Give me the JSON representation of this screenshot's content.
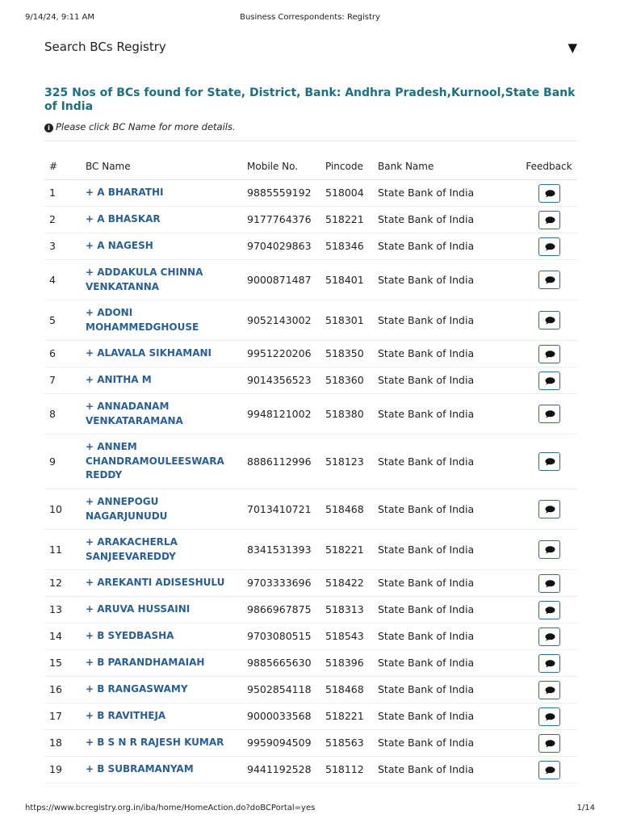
{
  "print_header": {
    "datetime": "9/14/24, 9:11 AM",
    "title": "Business Correspondents: Registry"
  },
  "search": {
    "label": "Search BCs Registry",
    "toggle_icon": "▼"
  },
  "result": {
    "heading": "325 Nos of BCs found for State, District, Bank: Andhra Pradesh,Kurnool,State Bank of India",
    "hint": "Please click BC Name for more details."
  },
  "table": {
    "headers": {
      "num": "#",
      "name": "BC Name",
      "mobile": "Mobile No.",
      "pincode": "Pincode",
      "bank": "Bank Name",
      "feedback": "Feedback"
    },
    "rows": [
      {
        "num": "1",
        "name": "+ A BHARATHI",
        "mobile": "9885559192",
        "pincode": "518004",
        "bank": "State Bank of India"
      },
      {
        "num": "2",
        "name": "+ A BHASKAR",
        "mobile": "9177764376",
        "pincode": "518221",
        "bank": "State Bank of India"
      },
      {
        "num": "3",
        "name": "+ A NAGESH",
        "mobile": "9704029863",
        "pincode": "518346",
        "bank": "State Bank of India"
      },
      {
        "num": "4",
        "name": "+ ADDAKULA CHINNA VENKATANNA",
        "mobile": "9000871487",
        "pincode": "518401",
        "bank": "State Bank of India"
      },
      {
        "num": "5",
        "name": "+ ADONI MOHAMMEDGHOUSE",
        "mobile": "9052143002",
        "pincode": "518301",
        "bank": "State Bank of India"
      },
      {
        "num": "6",
        "name": "+ ALAVALA SIKHAMANI",
        "mobile": "9951220206",
        "pincode": "518350",
        "bank": "State Bank of India"
      },
      {
        "num": "7",
        "name": "+ ANITHA M",
        "mobile": "9014356523",
        "pincode": "518360",
        "bank": "State Bank of India"
      },
      {
        "num": "8",
        "name": "+ ANNADANAM VENKATARAMANA",
        "mobile": "9948121002",
        "pincode": "518380",
        "bank": "State Bank of India"
      },
      {
        "num": "9",
        "name": "+ ANNEM CHANDRAMOULEESWARA REDDY",
        "mobile": "8886112996",
        "pincode": "518123",
        "bank": "State Bank of India"
      },
      {
        "num": "10",
        "name": "+ ANNEPOGU NAGARJUNUDU",
        "mobile": "7013410721",
        "pincode": "518468",
        "bank": "State Bank of India"
      },
      {
        "num": "11",
        "name": "+ ARAKACHERLA SANJEEVAREDDY",
        "mobile": "8341531393",
        "pincode": "518221",
        "bank": "State Bank of India"
      },
      {
        "num": "12",
        "name": "+ AREKANTI ADISESHULU",
        "mobile": "9703333696",
        "pincode": "518422",
        "bank": "State Bank of India"
      },
      {
        "num": "13",
        "name": "+ ARUVA HUSSAINI",
        "mobile": "9866967875",
        "pincode": "518313",
        "bank": "State Bank of India"
      },
      {
        "num": "14",
        "name": "+ B SYEDBASHA",
        "mobile": "9703080515",
        "pincode": "518543",
        "bank": "State Bank of India"
      },
      {
        "num": "15",
        "name": "+ B PARANDHAMAIAH",
        "mobile": "9885665630",
        "pincode": "518396",
        "bank": "State Bank of India"
      },
      {
        "num": "16",
        "name": "+ B RANGASWAMY",
        "mobile": "9502854118",
        "pincode": "518468",
        "bank": "State Bank of India"
      },
      {
        "num": "17",
        "name": "+ B RAVITHEJA",
        "mobile": "9000033568",
        "pincode": "518221",
        "bank": "State Bank of India"
      },
      {
        "num": "18",
        "name": "+ B S N R RAJESH KUMAR",
        "mobile": "9959094509",
        "pincode": "518563",
        "bank": "State Bank of India"
      },
      {
        "num": "19",
        "name": "+ B SUBRAMANYAM",
        "mobile": "9441192528",
        "pincode": "518112",
        "bank": "State Bank of India"
      }
    ],
    "feedback_icon": "comment-icon"
  },
  "print_footer": {
    "url": "https://www.bcregistry.org.in/iba/home/HomeAction.do?doBCPortal=yes",
    "page": "1/14"
  },
  "colors": {
    "heading": "#1f6f80",
    "link": "#2b5f8f",
    "button_border": "#2d6c95"
  }
}
